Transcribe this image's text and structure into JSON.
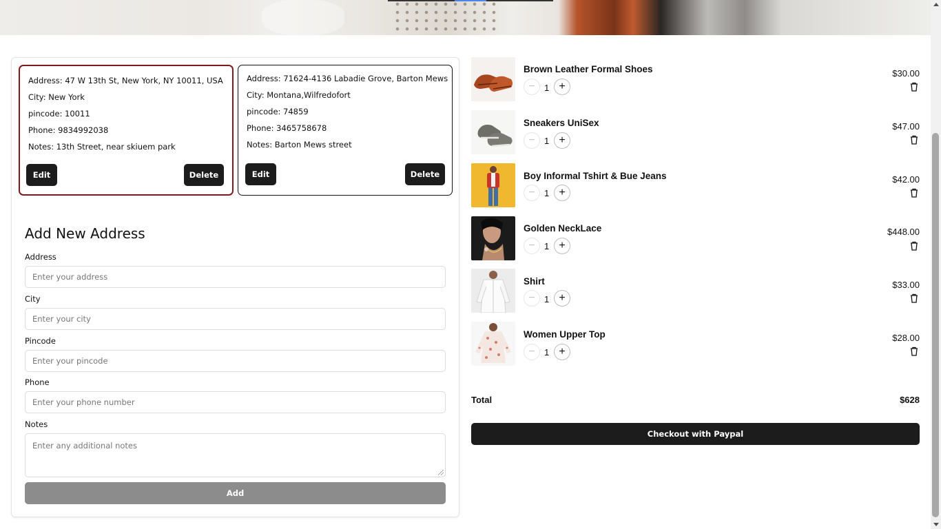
{
  "addresses": [
    {
      "address": "Address: 47 W 13th St, New York, NY 10011, USA",
      "city": "City: New York",
      "pincode": "pincode: 10011",
      "phone": "Phone: 9834992038",
      "notes": "Notes: 13th Street, near skiuem park",
      "edit_label": "Edit",
      "delete_label": "Delete",
      "selected": true
    },
    {
      "address": "Address: 71624-4136 Labadie Grove, Barton Mews",
      "city": "City: Montana,Wilfredofort",
      "pincode": "pincode: 74859",
      "phone": "Phone: 3465758678",
      "notes": "Notes: Barton Mews street",
      "edit_label": "Edit",
      "delete_label": "Delete",
      "selected": false
    }
  ],
  "form": {
    "title": "Add New Address",
    "address": {
      "label": "Address",
      "placeholder": "Enter your address"
    },
    "city": {
      "label": "City",
      "placeholder": "Enter your city"
    },
    "pincode": {
      "label": "Pincode",
      "placeholder": "Enter your pincode"
    },
    "phone": {
      "label": "Phone",
      "placeholder": "Enter your phone number"
    },
    "notes": {
      "label": "Notes",
      "placeholder": "Enter any additional notes"
    },
    "add_label": "Add"
  },
  "cart": {
    "items": [
      {
        "name": "Brown Leather Formal Shoes",
        "qty": "1",
        "price": "$30.00",
        "minus": "−",
        "plus": "+"
      },
      {
        "name": "Sneakers UniSex",
        "qty": "1",
        "price": "$47.00",
        "minus": "−",
        "plus": "+"
      },
      {
        "name": "Boy Informal Tshirt & Bue Jeans",
        "qty": "1",
        "price": "$42.00",
        "minus": "−",
        "plus": "+"
      },
      {
        "name": "Golden NeckLace",
        "qty": "1",
        "price": "$448.00",
        "minus": "−",
        "plus": "+"
      },
      {
        "name": "Shirt",
        "qty": "1",
        "price": "$33.00",
        "minus": "−",
        "plus": "+"
      },
      {
        "name": "Women Upper Top",
        "qty": "1",
        "price": "$28.00",
        "minus": "−",
        "plus": "+"
      }
    ],
    "total_label": "Total",
    "total_value": "$628",
    "checkout_label": "Checkout with Paypal"
  },
  "colors": {
    "selected_border": "#7d1a1e",
    "button_dark": "#1c1c1c",
    "button_disabled": "#8c8c8c",
    "slider_active": "#4a86e8"
  },
  "icons": {
    "trash": "trash-icon",
    "minus": "minus-icon",
    "plus": "plus-icon"
  }
}
